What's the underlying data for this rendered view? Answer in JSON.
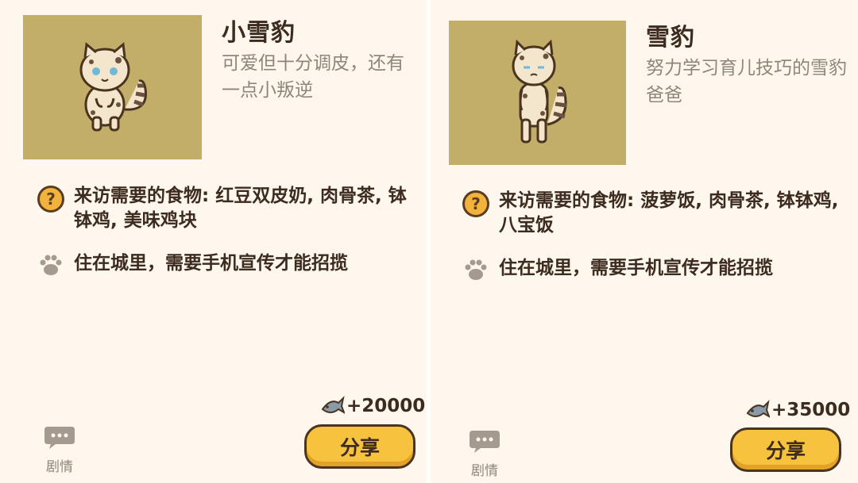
{
  "cards": [
    {
      "name": "小雪豹",
      "description": "可爱但十分调皮，还有一点小叛逆",
      "food_text": "来访需要的食物: 红豆双皮奶, 肉骨茶, 钵钵鸡, 美味鸡块",
      "home_text": "住在城里，需要手机宣传才能招揽",
      "reward": "+20000",
      "story_label": "剧情",
      "share_label": "分享"
    },
    {
      "name": "雪豹",
      "description": "努力学习育儿技巧的雪豹爸爸",
      "food_text": "来访需要的食物: 菠萝饭, 肉骨茶, 钵钵鸡, 八宝饭",
      "home_text": "住在城里，需要手机宣传才能招揽",
      "reward": "+35000",
      "story_label": "剧情",
      "share_label": "分享"
    }
  ],
  "icons": {
    "question": "question-icon",
    "paw": "paw-icon",
    "fish": "fish-icon",
    "speech": "speech-bubble-icon"
  },
  "colors": {
    "background": "#fdf7ee",
    "portrait_bg": "#c2ad69",
    "accent_yellow": "#f7c33e",
    "text_dark": "#3d2b1f",
    "text_muted": "#8f857a"
  }
}
